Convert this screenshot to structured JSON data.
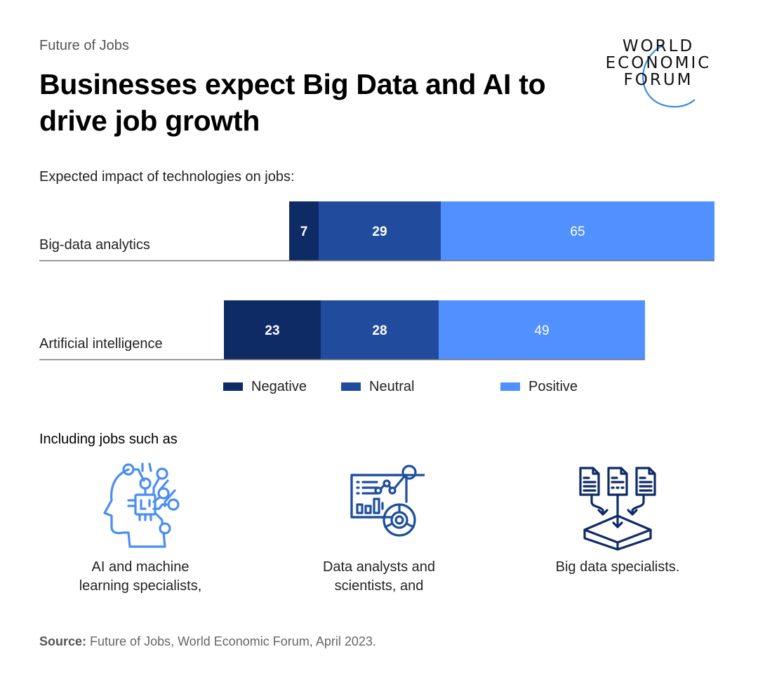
{
  "header": {
    "kicker": "Future of Jobs",
    "title": "Businesses expect Big Data and AI to drive job growth",
    "logo": {
      "line1": "WORLD",
      "line2": "ECONOMIC",
      "line3": "FORUM",
      "arc_color": "#3b8de0"
    }
  },
  "chart_data": {
    "type": "bar",
    "orientation": "horizontal-stacked",
    "title": "Expected impact of technologies on jobs:",
    "xlabel": "",
    "ylabel": "",
    "grid": false,
    "alignment": "centered on neutral segment",
    "categories": [
      "Big-data analytics",
      "Artificial intelligence"
    ],
    "series": [
      {
        "name": "Negative",
        "color": "#0f2b66",
        "values": [
          7,
          23
        ]
      },
      {
        "name": "Neutral",
        "color": "#214c9d",
        "values": [
          29,
          28
        ]
      },
      {
        "name": "Positive",
        "color": "#5191ff",
        "values": [
          65,
          49
        ]
      }
    ],
    "data_labels": true,
    "legend": {
      "placement": "bottom",
      "entries": [
        "Negative",
        "Neutral",
        "Positive"
      ]
    }
  },
  "jobs": {
    "heading": "Including jobs such as",
    "items": [
      {
        "icon": "ai-head-chip-icon",
        "label_line1": "AI and machine",
        "label_line2": "learning specialists,"
      },
      {
        "icon": "data-dashboard-icon",
        "label_line1": "Data analysts and",
        "label_line2": "scientists, and"
      },
      {
        "icon": "documents-to-database-icon",
        "label_line1": "Big data specialists.",
        "label_line2": ""
      }
    ]
  },
  "source": {
    "prefix": "Source:",
    "text": " Future of Jobs, World Economic Forum, April 2023."
  }
}
